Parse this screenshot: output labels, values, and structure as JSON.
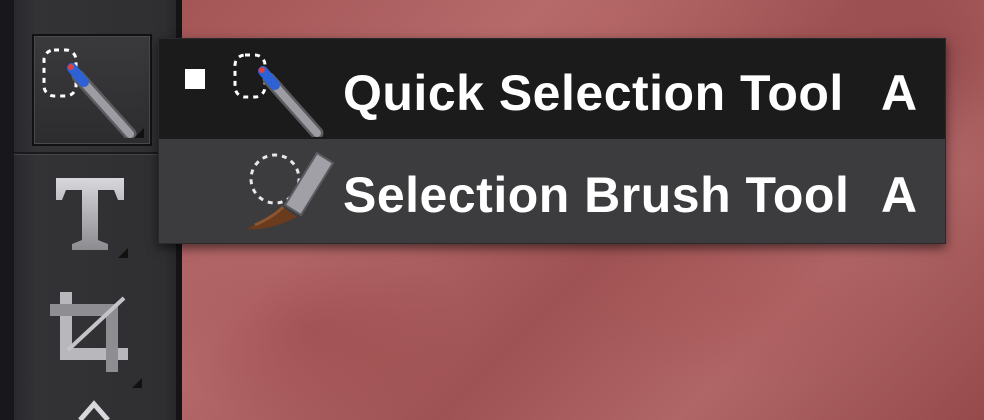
{
  "toolbar": {
    "tools": [
      {
        "icon": "brush-icon"
      },
      {
        "icon": "quick-selection-icon",
        "active": true
      },
      {
        "icon": "type-icon",
        "glyph": "T"
      },
      {
        "icon": "crop-icon"
      },
      {
        "icon": "eraser-icon"
      }
    ]
  },
  "flyout": {
    "items": [
      {
        "label": "Quick Selection Tool",
        "shortcut": "A",
        "icon": "quick-selection-icon",
        "checked": true
      },
      {
        "label": "Selection Brush Tool",
        "shortcut": "A",
        "icon": "selection-brush-icon",
        "checked": false
      }
    ]
  },
  "colors": {
    "menu_selected_bg": "#1b1b1c",
    "menu_bg": "#3c3c3e",
    "panel_bg": "#2f2f32",
    "canvas": "#a45556"
  }
}
